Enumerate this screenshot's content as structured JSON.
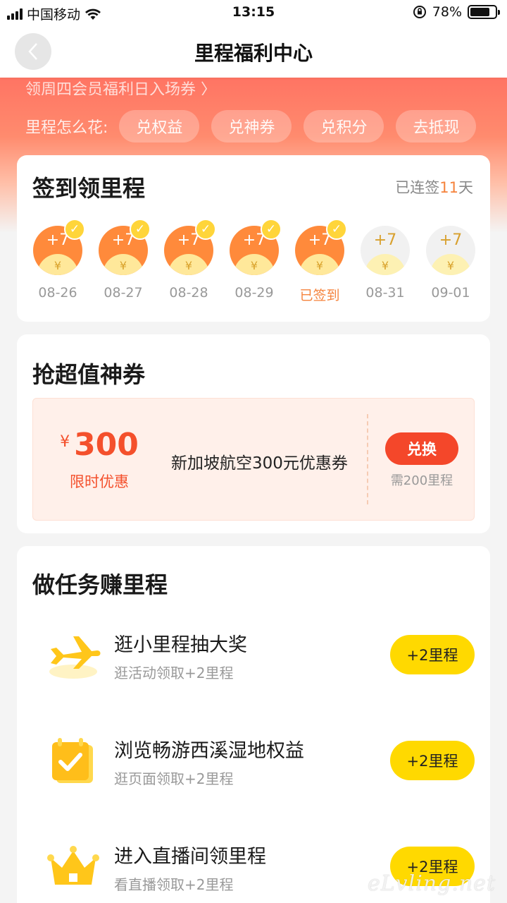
{
  "status_bar": {
    "carrier": "中国移动",
    "time": "13:15",
    "battery": "78%",
    "battery_level": 0.78
  },
  "nav": {
    "title": "里程福利中心"
  },
  "hero": {
    "link_text": "领周四会员福利日入场券 〉",
    "spend_label": "里程怎么花:",
    "chips": [
      "兑权益",
      "兑神券",
      "兑积分",
      "去抵现"
    ]
  },
  "signin": {
    "title": "签到领里程",
    "streak_prefix": "已连签",
    "streak_days": "11",
    "streak_suffix": "天",
    "days": [
      {
        "reward": "+7",
        "label": "08-26",
        "signed": true,
        "today": false
      },
      {
        "reward": "+7",
        "label": "08-27",
        "signed": true,
        "today": false
      },
      {
        "reward": "+7",
        "label": "08-28",
        "signed": true,
        "today": false
      },
      {
        "reward": "+7",
        "label": "08-29",
        "signed": true,
        "today": false
      },
      {
        "reward": "+7",
        "label": "已签到",
        "signed": true,
        "today": true
      },
      {
        "reward": "+7",
        "label": "08-31",
        "signed": false,
        "today": false
      },
      {
        "reward": "+7",
        "label": "09-01",
        "signed": false,
        "today": false
      }
    ],
    "coin_symbol": "¥"
  },
  "coupon_section": {
    "title": "抢超值神券",
    "currency": "¥",
    "amount": "300",
    "tag": "限时优惠",
    "name": "新加坡航空300元优惠券",
    "button": "兑换",
    "need": "需200里程"
  },
  "tasks": {
    "title": "做任务赚里程",
    "items": [
      {
        "icon": "plane-icon",
        "title": "逛小里程抽大奖",
        "sub": "逛活动领取+2里程",
        "button": "+2里程"
      },
      {
        "icon": "calendar-check-icon",
        "title": "浏览畅游西溪湿地权益",
        "sub": "逛页面领取+2里程",
        "button": "+2里程"
      },
      {
        "icon": "crown-icon",
        "title": "进入直播间领里程",
        "sub": "看直播领取+2里程",
        "button": "+2里程"
      }
    ]
  },
  "watermark": "eLvling.net"
}
